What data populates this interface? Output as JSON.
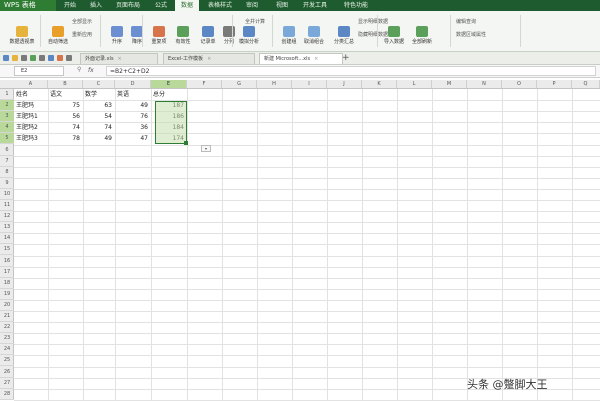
{
  "app": {
    "title": "WPS 表格"
  },
  "menu": [
    "开始",
    "插入",
    "页面布局",
    "公式",
    "数据",
    "表格样式",
    "审阅",
    "视图",
    "开发工具",
    "特色功能"
  ],
  "menu_active": "数据",
  "ribbon": {
    "buttons": [
      "数据透视表",
      "自动筛选",
      "升序",
      "降序",
      "重复项",
      "有效性",
      "记录单",
      "分列",
      "模拟分析",
      "创建组",
      "取消组合",
      "分类汇总",
      "导入数据",
      "全部刷新"
    ],
    "small_items": [
      "全部显示",
      "重新应用",
      "全并计算",
      "显示明细数据",
      "隐藏明细数据",
      "编辑查询",
      "数据区域属性"
    ]
  },
  "doc_tabs": [
    "外面记录.xls",
    "Excel-工作模板",
    "新建 Microsoft...xls"
  ],
  "formula_bar": {
    "cell_ref": "E2",
    "formula": "=B2+C2+D2",
    "fx": "fx"
  },
  "columns": [
    "A",
    "B",
    "C",
    "D",
    "E",
    "F",
    "G",
    "H",
    "I",
    "J",
    "K",
    "L",
    "M",
    "N",
    "O",
    "P",
    "Q"
  ],
  "table": {
    "headers": [
      "姓名",
      "语文",
      "数学",
      "英语",
      "总分"
    ],
    "rows": [
      [
        "王肥玛",
        "75",
        "63",
        "49",
        "187"
      ],
      [
        "王肥玛1",
        "56",
        "54",
        "76",
        "186"
      ],
      [
        "王肥玛2",
        "74",
        "74",
        "36",
        "184"
      ],
      [
        "王肥玛3",
        "78",
        "49",
        "47",
        "174"
      ]
    ]
  },
  "watermark": "头条 @蹩脚大王",
  "colors": {
    "menubar": "#1e5b2e",
    "accent": "#2f7d32",
    "selection": "#c4e0af"
  }
}
